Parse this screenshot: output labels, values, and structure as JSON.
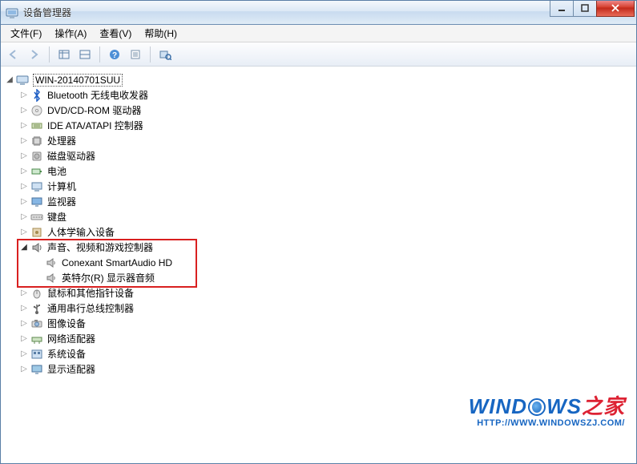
{
  "window": {
    "title": "设备管理器"
  },
  "menus": {
    "file": "文件(F)",
    "action": "操作(A)",
    "view": "查看(V)",
    "help": "帮助(H)"
  },
  "tree": {
    "root": "WIN-20140701SUU",
    "items": [
      {
        "label": "Bluetooth 无线电收发器",
        "icon": "bluetooth"
      },
      {
        "label": "DVD/CD-ROM 驱动器",
        "icon": "disc"
      },
      {
        "label": "IDE ATA/ATAPI 控制器",
        "icon": "ide"
      },
      {
        "label": "处理器",
        "icon": "cpu"
      },
      {
        "label": "磁盘驱动器",
        "icon": "disk"
      },
      {
        "label": "电池",
        "icon": "battery"
      },
      {
        "label": "计算机",
        "icon": "computer"
      },
      {
        "label": "监视器",
        "icon": "monitor"
      },
      {
        "label": "键盘",
        "icon": "keyboard"
      },
      {
        "label": "人体学输入设备",
        "icon": "hid"
      },
      {
        "label": "声音、视频和游戏控制器",
        "icon": "sound",
        "expanded": true,
        "children": [
          {
            "label": "Conexant SmartAudio HD",
            "icon": "speaker"
          },
          {
            "label": "英特尔(R) 显示器音频",
            "icon": "speaker"
          }
        ]
      },
      {
        "label": "鼠标和其他指针设备",
        "icon": "mouse"
      },
      {
        "label": "通用串行总线控制器",
        "icon": "usb"
      },
      {
        "label": "图像设备",
        "icon": "camera"
      },
      {
        "label": "网络适配器",
        "icon": "network"
      },
      {
        "label": "系统设备",
        "icon": "system"
      },
      {
        "label": "显示适配器",
        "icon": "display"
      }
    ]
  },
  "watermark": {
    "line1_a": "WIND",
    "line1_b": "WS",
    "line1_c": "之家",
    "line2": "HTTP://WWW.WINDOWSZJ.COM/"
  }
}
